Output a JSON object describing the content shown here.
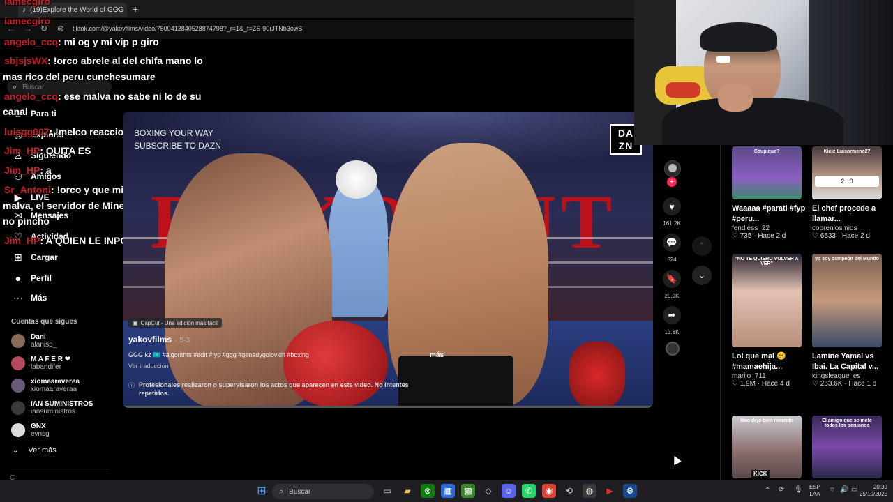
{
  "browser": {
    "tab_title": "(19)Explore the World of GGG",
    "tab_close": "×",
    "new_tab": "+",
    "url": "tiktok.com/@yakovfilms/video/7500412840528874798?_r=1&_t=ZS-90rJTNb3owS"
  },
  "sidebar": {
    "search_placeholder": "Buscar",
    "items": [
      {
        "label": "Para ti",
        "icon": "home-icon"
      },
      {
        "label": "Explorar",
        "icon": "compass-icon"
      },
      {
        "label": "Siguiendo",
        "icon": "following-icon"
      },
      {
        "label": "Amigos",
        "icon": "friends-icon"
      },
      {
        "label": "LIVE",
        "icon": "live-icon"
      },
      {
        "label": "Mensajes",
        "icon": "message-icon"
      },
      {
        "label": "Actividad",
        "icon": "activity-icon"
      },
      {
        "label": "Cargar",
        "icon": "upload-icon"
      },
      {
        "label": "Perfil",
        "icon": "profile-icon"
      },
      {
        "label": "Más",
        "icon": "more-icon"
      }
    ],
    "following_header": "Cuentas que sigues",
    "following": [
      {
        "name": "Dani",
        "handle": "alanisp_"
      },
      {
        "name": "M A F E R ❤",
        "handle": "labandifer"
      },
      {
        "name": "xiomaaraverea",
        "handle": "xiomaaraveraa"
      },
      {
        "name": "IAN SUMINISTROS",
        "handle": "iansuministros"
      },
      {
        "name": "GNX",
        "handle": "evnsg"
      }
    ],
    "see_more": "Ver más",
    "cutoff_text": "C"
  },
  "video": {
    "watermark_line1": "BOXING YOUR WAY",
    "watermark_line2": "SUBSCRIBE TO DAZN",
    "dazn_logo": "DA ZN",
    "capcut_badge": "CapCut - Una edición más fácil",
    "author": "yakovfilms",
    "date": "5-3",
    "caption": "GGG kz 🇰🇿 #algorithm #edit #fyp #ggg #genadygolovkin #boxing",
    "more": "más",
    "translate": "Ver traducción",
    "disclaimer": "Profesionales realizaron o supervisaron los actos que aparecen en este video. No intentes repetirlos.",
    "bg_text": "BY KO OUT"
  },
  "actions": {
    "likes": "161.2K",
    "comments": "624",
    "saves": "29.9K",
    "shares": "13.8K"
  },
  "chat": [
    {
      "user": "iamecgiro",
      "msg": ""
    },
    {
      "user": "iamecgiro",
      "msg": ""
    },
    {
      "user": "angelo_ccq",
      "msg": ": mi og y mi vip p giro"
    },
    {
      "user": "sbjsjsWX",
      "msg": ": !orco abrele al del chifa mano lo"
    },
    {
      "user": "",
      "msg": "mas rico del peru cunchesumare"
    },
    {
      "user": "angelo_ccq",
      "msg": ": ese malva no sabe ni lo de su"
    },
    {
      "user": "",
      "msg": "canal"
    },
    {
      "user": "luisgg007",
      "msg": ": !melco reacciona todo gordo"
    },
    {
      "user": "Jim_HP",
      "msg": ": QUITA ES"
    },
    {
      "user": "Jim_HP",
      "msg": ": a"
    },
    {
      "user": "Sr_Antoni",
      "msg": ": !orco y que mierda harás hoy"
    },
    {
      "user": "",
      "msg": "malva, el servidor de Minecraft sigue vivo o"
    },
    {
      "user": "",
      "msg": "no pincho"
    },
    {
      "user": "Jim_HP",
      "msg": ": A QUIEN LE INPORTA"
    }
  ],
  "recommendations": [
    {
      "title": "Waaaaa #parati #fyp #peru...",
      "author": "fendless_22",
      "likes": "735",
      "age": "Hace 2 d",
      "thumb_text": "Coupique?"
    },
    {
      "title": "El chef procede a llamar...",
      "author": "cobrenlosmios",
      "likes": "6533",
      "age": "Hace 2 d",
      "thumb_text": "Kick: Luisormeno27",
      "thumb_scores": "2   0"
    },
    {
      "title": "Lol que mal 🥴 #mamaehija...",
      "author": "marijo_711",
      "likes": "1.9M",
      "age": "Hace 4 d",
      "thumb_text": "\"NO TE QUIERO VOLVER A VER\""
    },
    {
      "title": "Lamine Yamal vs Ibai. La Capital v...",
      "author": "kingsleague_es",
      "likes": "263.6K",
      "age": "Hace 1 d",
      "thumb_text": "yo soy campeón del Mundo"
    },
    {
      "title": "",
      "author": "",
      "likes": "",
      "age": "",
      "thumb_text": "Mao deja bien rimando"
    },
    {
      "title": "",
      "author": "",
      "likes": "",
      "age": "",
      "thumb_text": "El amigo que se mete todos los peruanos"
    }
  ],
  "rec_bottom_label": "KICK",
  "taskbar": {
    "search": "Buscar",
    "lang1": "ESP",
    "lang2": "LAA",
    "time": "20:39",
    "date": "25/10/2025"
  },
  "colors": {
    "chat_username": "#c52027",
    "tiktok_red": "#fe2c55",
    "background": "#000000"
  }
}
